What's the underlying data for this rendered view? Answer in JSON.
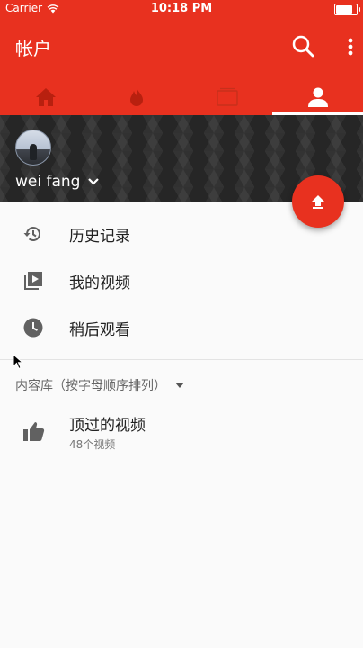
{
  "status_bar": {
    "carrier": "Carrier",
    "time": "10:18 PM",
    "battery_level": 0.9
  },
  "app_bar": {
    "title": "帐户"
  },
  "tabs": [
    {
      "icon": "home-icon",
      "active": false
    },
    {
      "icon": "trending-icon",
      "active": false
    },
    {
      "icon": "subscriptions-icon",
      "active": false
    },
    {
      "icon": "account-icon",
      "active": true
    }
  ],
  "profile": {
    "username": "wei fang"
  },
  "menu": {
    "items": [
      {
        "label": "历史记录",
        "icon": "history-icon"
      },
      {
        "label": "我的视频",
        "icon": "my-videos-icon"
      },
      {
        "label": "稍后观看",
        "icon": "watch-later-icon"
      }
    ]
  },
  "library": {
    "header": "内容库（按字母顺序排列）",
    "playlists": [
      {
        "name": "顶过的视频",
        "count": "48个视频",
        "icon": "thumbs-up-icon"
      }
    ]
  },
  "colors": {
    "brand": "#e8311f",
    "background": "#fafafa",
    "banner": "#262626"
  }
}
